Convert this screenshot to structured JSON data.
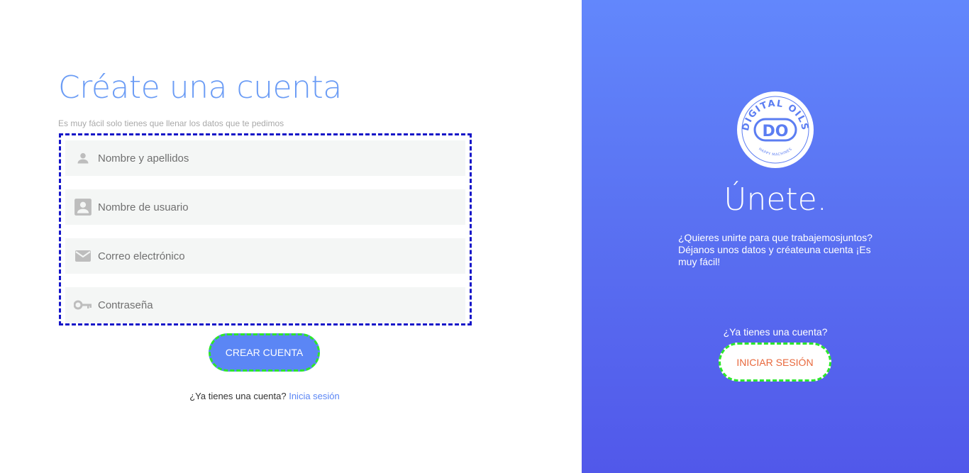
{
  "signup": {
    "title": "Créate una cuenta",
    "subtitle": "Es muy fácil solo tienes que llenar los datos que te pedimos",
    "fields": [
      {
        "placeholder": "Nombre y apellidos",
        "icon": "person-icon"
      },
      {
        "placeholder": "Nombre de usuario",
        "icon": "account-box-icon"
      },
      {
        "placeholder": "Correo electrónico",
        "icon": "email-icon"
      },
      {
        "placeholder": "Contraseña",
        "icon": "key-icon"
      }
    ],
    "submit_label": "CREAR CUENTA",
    "footer_question": "¿Ya tienes una cuenta?",
    "footer_link": "Inicia sesión"
  },
  "join": {
    "logo_text": "DIGITAL OILS",
    "logo_initials": "DO",
    "logo_tagline": "HAPPY MACHINES",
    "title": "Únete.",
    "description": "¿Quieres unirte para que trabajemosjuntos? Déjanos unos datos y créateuna cuenta ¡Es muy fácil!",
    "question": "¿Ya tienes una cuenta?",
    "login_label": "INICIAR SESIÓN"
  },
  "colors": {
    "accent": "#5b86f5",
    "login_text": "#e8683c",
    "field_bg": "#f4f6f5"
  }
}
